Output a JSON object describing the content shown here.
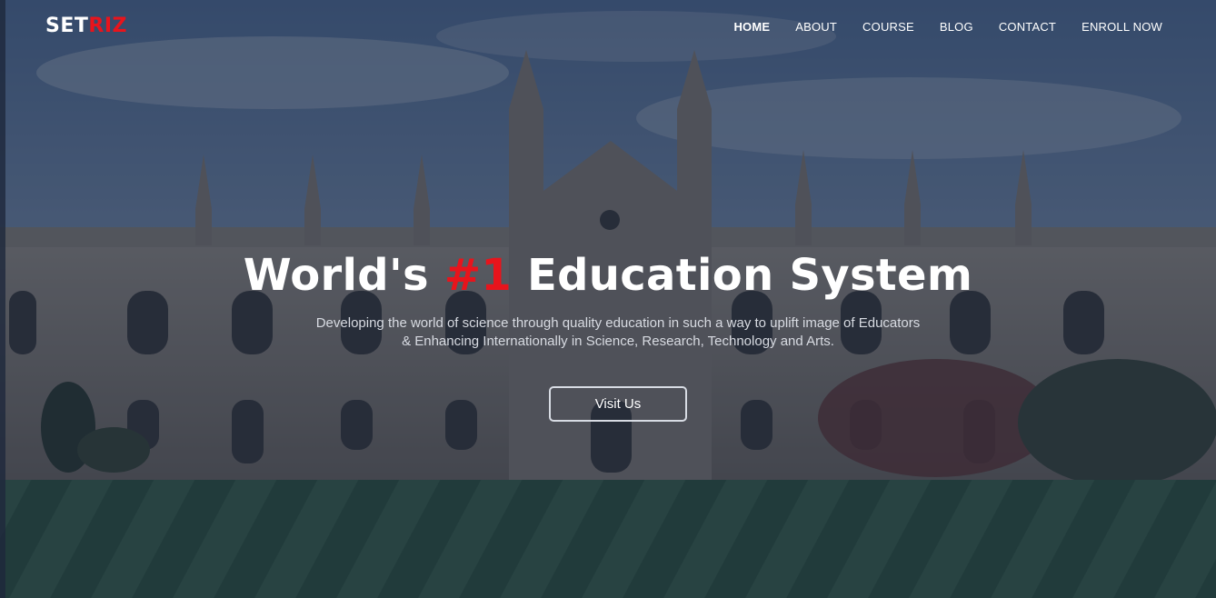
{
  "brand": {
    "logo_part1": "SET",
    "logo_part2": "RIZ"
  },
  "nav": {
    "items": [
      {
        "label": "HOME",
        "active": true
      },
      {
        "label": "ABOUT",
        "active": false
      },
      {
        "label": "COURSE",
        "active": false
      },
      {
        "label": "BLOG",
        "active": false
      },
      {
        "label": "CONTACT",
        "active": false
      },
      {
        "label": "ENROLL NOW",
        "active": false
      }
    ]
  },
  "hero": {
    "title_before": "World's ",
    "title_highlight": "#1",
    "title_after": " Education System",
    "subtitle_line1": "Developing the world of science through quality education in such a way to uplift image of Educators",
    "subtitle_line2": "& Enhancing Internationally in Science, Research, Technology and Arts.",
    "cta_label": "Visit Us",
    "background_image": "gothic-college-building-with-lawn"
  },
  "colors": {
    "accent": "#e8141c",
    "overlay": "#16223a",
    "text": "#ffffff"
  }
}
